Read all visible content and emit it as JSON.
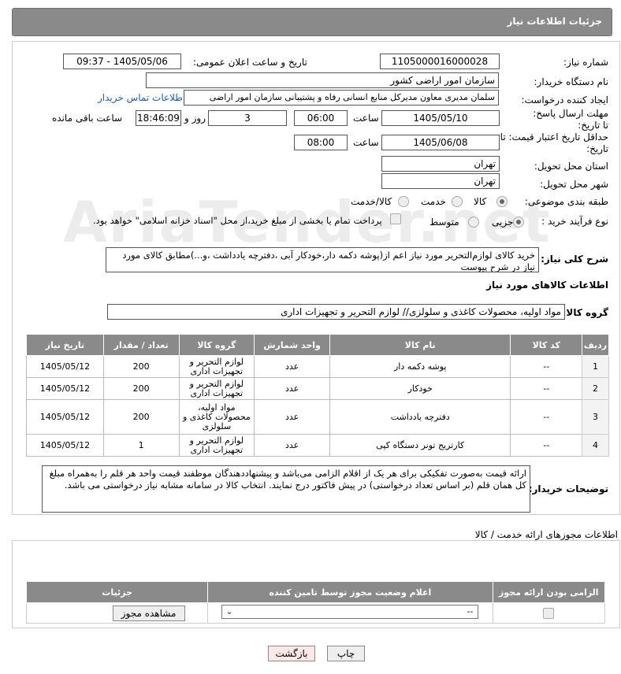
{
  "header": {
    "title": "جزئیات اطلاعات نیاز"
  },
  "form": {
    "need_number_label": "شماره نیاز:",
    "need_number": "1105000016000028",
    "announce_label": "تاریخ و ساعت اعلان عمومی:",
    "announce_value": "1405/05/06 - 09:37",
    "buyer_org_label": "نام دستگاه خریدار:",
    "buyer_org": "سازمان امور اراضی کشور",
    "requester_label": "ایجاد کننده درخواست:",
    "requester": "سلمان مدیری معاون مدیرکل منابع انسانی رفاه و پشتیبانی سازمان امور اراضی",
    "contact_link": "اطلاعات تماس خریدار",
    "deadline_label": "مهلت ارسال پاسخ: تا تاریخ:",
    "deadline_date": "1405/05/10",
    "time_label": "ساعت",
    "deadline_time": "06:00",
    "days_value": "3",
    "days_label": "روز و",
    "remain_time": "18:46:09",
    "remain_label": "ساعت باقی مانده",
    "price_valid_label": "حداقل تاریخ اعتبار قیمت: تا تاریخ:",
    "price_valid_date": "1405/06/08",
    "price_valid_time": "08:00",
    "province_label": "استان محل تحویل:",
    "province": "تهران",
    "city_label": "شهر محل تحویل:",
    "city": "تهران",
    "category_label": "طبقه بندی موضوعی:",
    "category_options": [
      "کالا",
      "خدمت",
      "کالا/خدمت"
    ],
    "purchase_type_label": "نوع فرآیند خرید :",
    "purchase_options": [
      "جزیی",
      "متوسط"
    ],
    "payment_note": "پرداخت تمام یا بخشی از مبلغ خرید،از محل \"اسناد خزانه اسلامی\" خواهد بود.",
    "desc_label": "شرح کلی نیاز:",
    "desc_text": "خرید کالای لوازم‌التحریر مورد نیاز اعم از(پوشه دکمه دار،خودکار آبی ،دفترچه یادداشت ،و...)مطابق کالای مورد نیاز در شرح پیوست"
  },
  "goods": {
    "section_title": "اطلاعات کالاهای مورد نیاز",
    "group_label": "گروه کالا:",
    "group_value": "مواد اولیه، محصولات کاغذی و سلولزی// لوازم التحریر و تجهیزات اداری",
    "columns": [
      "ردیف",
      "کد کالا",
      "نام کالا",
      "واحد شمارش",
      "گروه کالا",
      "تعداد / مقدار",
      "تاریخ نیاز"
    ],
    "rows": [
      {
        "row": "1",
        "code": "--",
        "name": "پوشه دکمه دار",
        "unit": "عدد",
        "group": "لوازم التحریر و تجهیزات اداری",
        "qty": "200",
        "date": "1405/05/12"
      },
      {
        "row": "2",
        "code": "--",
        "name": "خودکار",
        "unit": "عدد",
        "group": "لوازم التحریر و تجهیزات اداری",
        "qty": "200",
        "date": "1405/05/12"
      },
      {
        "row": "3",
        "code": "--",
        "name": "دفترچه یادداشت",
        "unit": "عدد",
        "group": "مواد اولیه، محصولات کاغذی و سلولزی",
        "qty": "200",
        "date": "1405/05/12"
      },
      {
        "row": "4",
        "code": "--",
        "name": "کارتریج تونر دستگاه کپی",
        "unit": "عدد",
        "group": "لوازم التحریر و تجهیزات اداری",
        "qty": "1",
        "date": "1405/05/12"
      }
    ],
    "buyer_notes_label": "توضیحات خریدار:",
    "buyer_notes": "ارائه قیمت به‌صورت تفکیکی برای هر یک از اقلام الزامی می‌باشد و پیشنهاددهندگان موظفند قیمت واحد هر قلم را به‌همراه مبلغ کل همان قلم (بر اساس تعداد درخواستی) در پیش فاکتور درج نمایند. انتخاب کالا در سامانه مشابه نیاز درخواستی می باشد."
  },
  "permits": {
    "section_title": "اطلاعات مجوزهای ارائه خدمت / کالا",
    "columns": [
      "الزامی بودن ارائه مجوز",
      "اعلام وضعیت مجوز توسط تامین کننده",
      "جزئیات"
    ],
    "select_value": "--",
    "view_button": "مشاهده مجوز"
  },
  "actions": {
    "print": "چاپ",
    "back": "بازگشت"
  },
  "watermark": "AriaTender.net"
}
